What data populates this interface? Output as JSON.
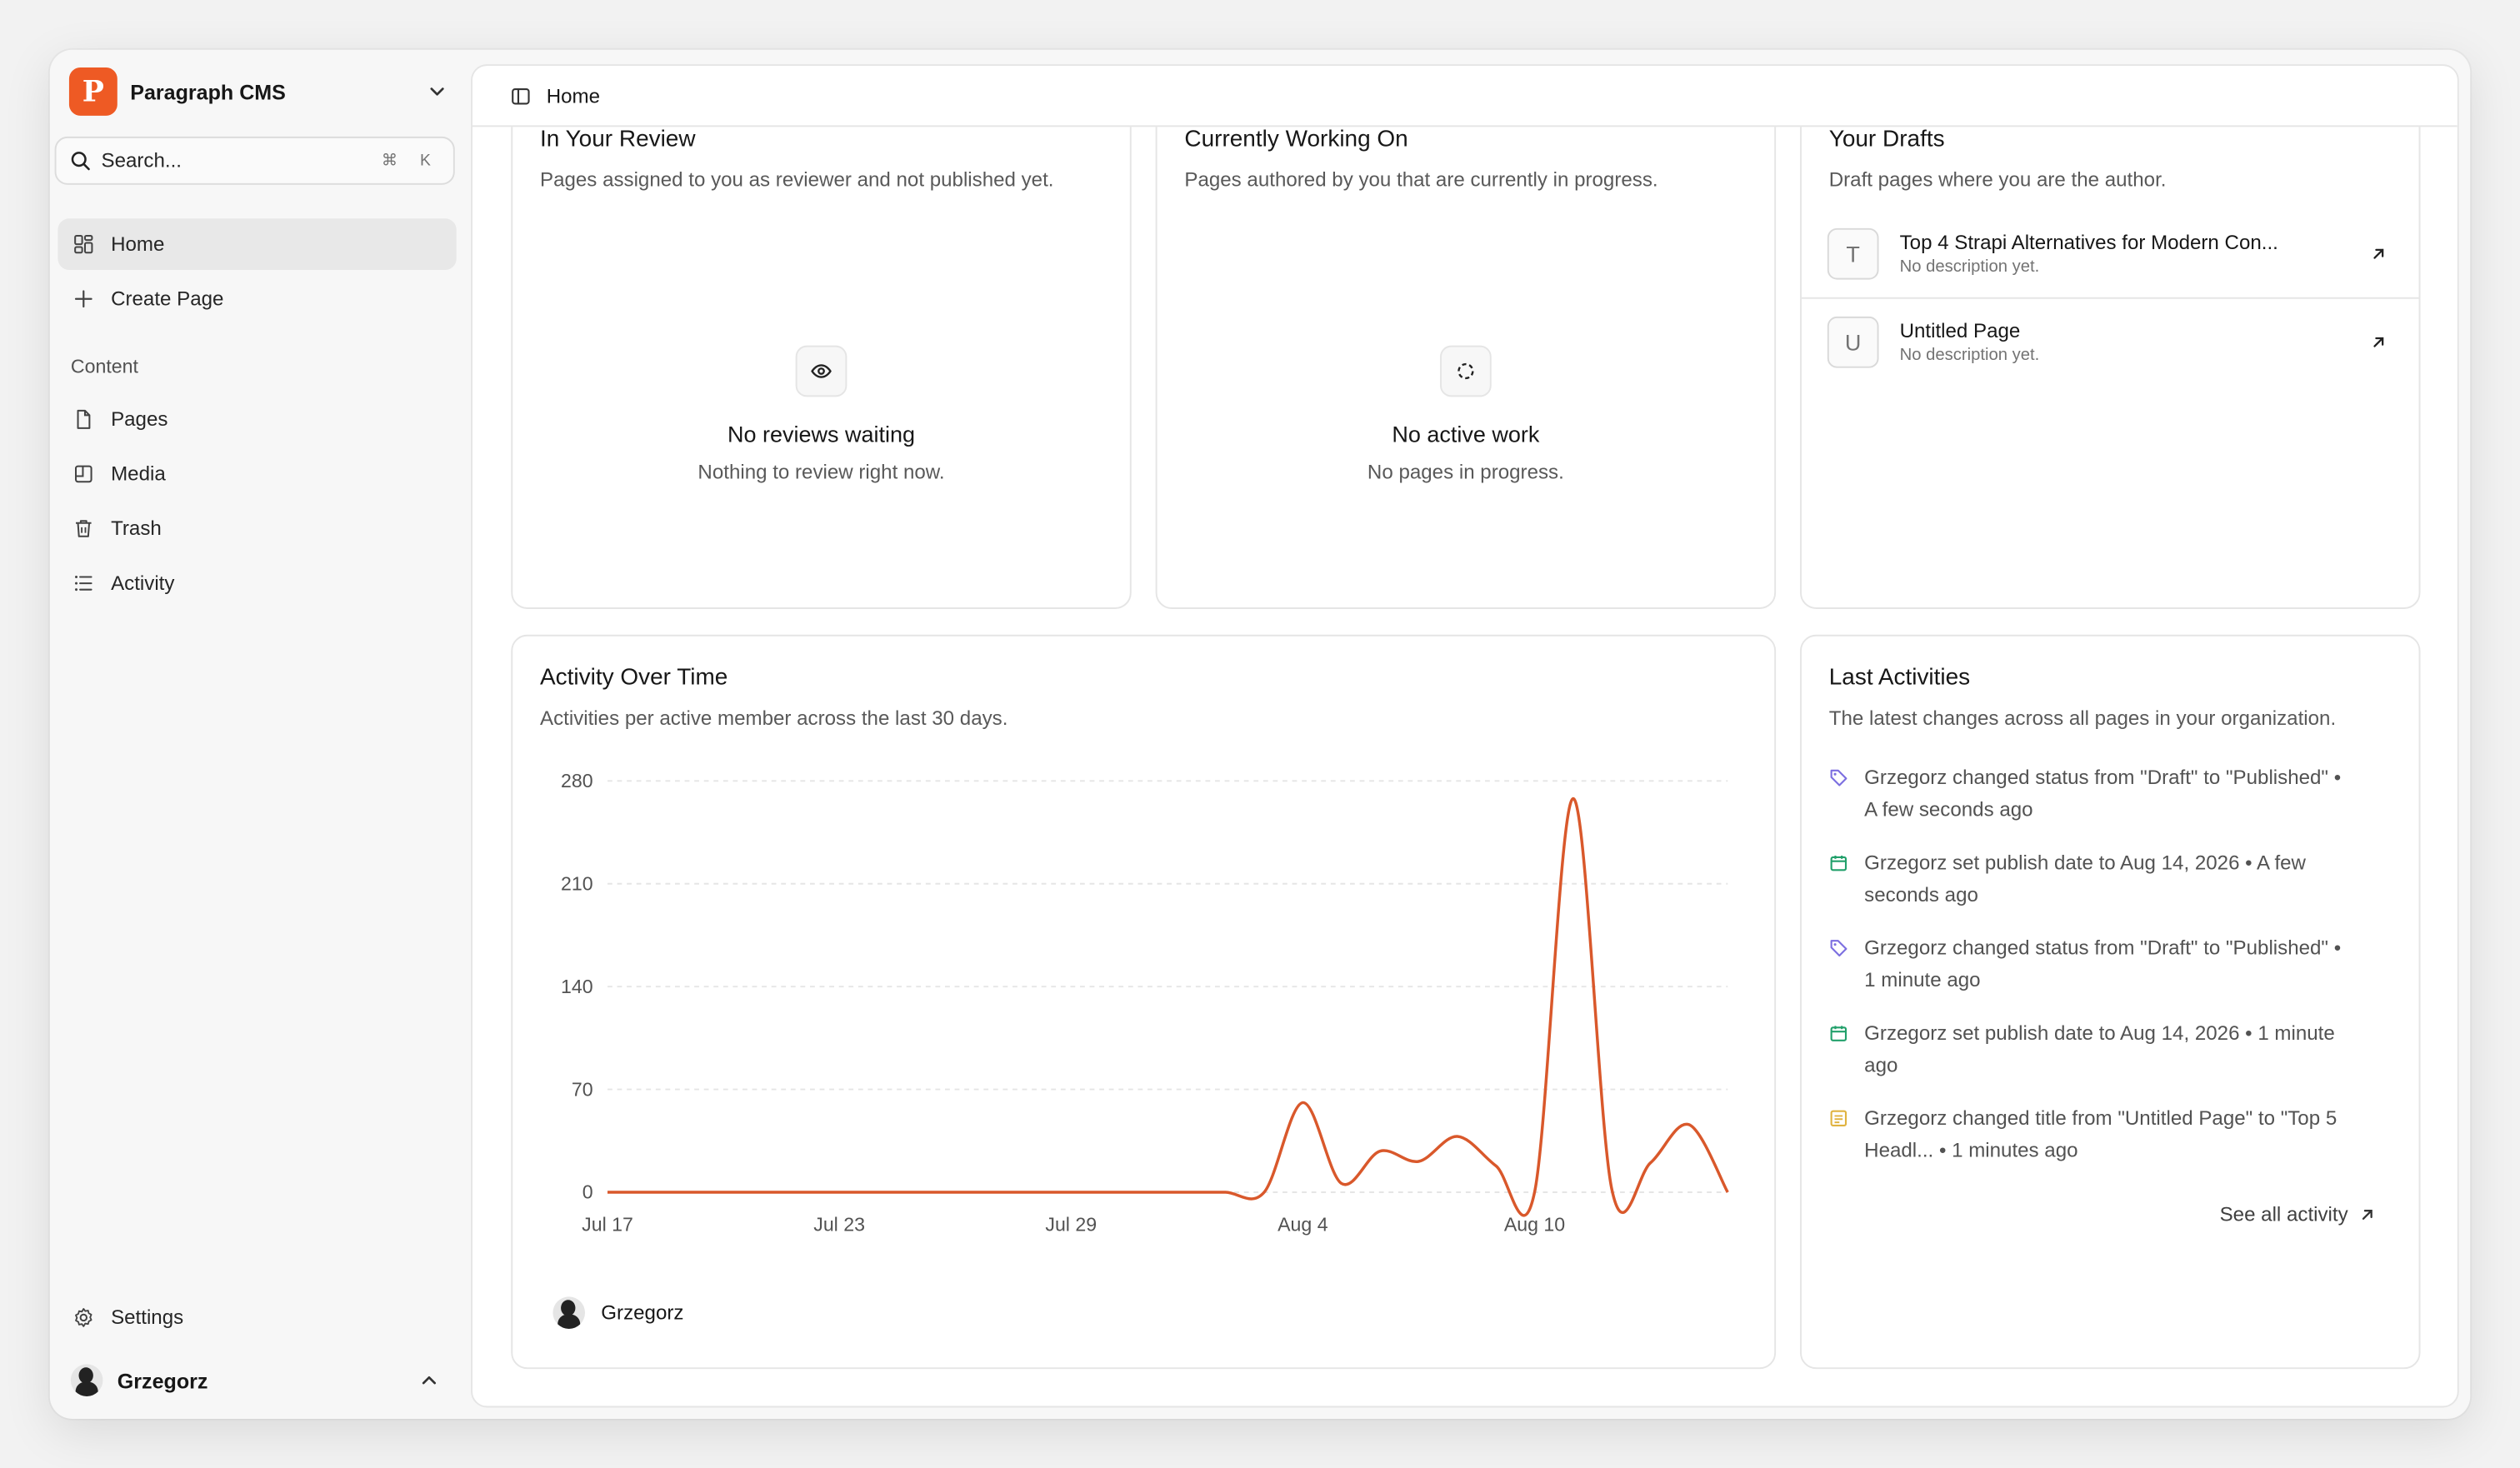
{
  "brand": {
    "name": "Paragraph CMS",
    "logo_glyph": "P",
    "color": "#ee5a24"
  },
  "search": {
    "placeholder": "Search...",
    "shortcut_mod": "⌘",
    "shortcut_key": "K"
  },
  "sidebar": {
    "items": [
      {
        "label": "Home",
        "icon": "home-grid-icon",
        "active": true
      },
      {
        "label": "Create Page",
        "icon": "plus-icon"
      }
    ],
    "section_label": "Content",
    "content_items": [
      {
        "label": "Pages",
        "icon": "file-icon"
      },
      {
        "label": "Media",
        "icon": "image-icon"
      },
      {
        "label": "Trash",
        "icon": "trash-icon"
      },
      {
        "label": "Activity",
        "icon": "list-icon"
      }
    ],
    "settings_label": "Settings",
    "user_name": "Grzegorz"
  },
  "topbar": {
    "title": "Home"
  },
  "review_card": {
    "title": "In Your Review",
    "subtitle": "Pages assigned to you as reviewer and not published yet.",
    "empty_title": "No reviews waiting",
    "empty_subtitle": "Nothing to review right now."
  },
  "working_card": {
    "title": "Currently Working On",
    "subtitle": "Pages authored by you that are currently in progress.",
    "empty_title": "No active work",
    "empty_subtitle": "No pages in progress."
  },
  "drafts_card": {
    "title": "Your Drafts",
    "subtitle": "Draft pages where you are the author.",
    "items": [
      {
        "letter": "T",
        "title": "Top 4 Strapi Alternatives for Modern Con...",
        "description": "No description yet."
      },
      {
        "letter": "U",
        "title": "Untitled Page",
        "description": "No description yet."
      }
    ]
  },
  "activity_chart_card": {
    "title": "Activity Over Time",
    "subtitle": "Activities per active member across the last 30 days.",
    "legend_name": "Grzegorz"
  },
  "chart_data": {
    "type": "line",
    "x_tick_labels": [
      "Jul 17",
      "Jul 23",
      "Jul 29",
      "Aug 4",
      "Aug 10"
    ],
    "y_ticks": [
      0,
      70,
      140,
      210,
      280
    ],
    "ylim": [
      0,
      280
    ],
    "grid": true,
    "color": "#d9582b",
    "series": [
      {
        "name": "Grzegorz",
        "x": [
          "Jul 17",
          "Jul 18",
          "Jul 19",
          "Jul 20",
          "Jul 21",
          "Jul 22",
          "Jul 23",
          "Jul 24",
          "Jul 25",
          "Jul 26",
          "Jul 27",
          "Jul 28",
          "Jul 29",
          "Jul 30",
          "Jul 31",
          "Aug 1",
          "Aug 2",
          "Aug 3",
          "Aug 4",
          "Aug 5",
          "Aug 6",
          "Aug 7",
          "Aug 8",
          "Aug 9",
          "Aug 10",
          "Aug 11",
          "Aug 12",
          "Aug 13",
          "Aug 14",
          "Aug 15"
        ],
        "values": [
          0,
          0,
          0,
          0,
          0,
          0,
          0,
          0,
          0,
          0,
          0,
          0,
          0,
          0,
          0,
          0,
          0,
          0,
          61,
          6,
          28,
          21,
          38,
          18,
          0,
          268,
          2,
          20,
          46,
          0
        ]
      }
    ]
  },
  "last_activities": {
    "title": "Last Activities",
    "subtitle": "The latest changes across all pages in your organization.",
    "items": [
      {
        "icon": "tag-icon",
        "color": "#7c6fe0",
        "line1": "Grzegorz changed status from \"Draft\" to \"Published\" •",
        "line2": "A few seconds ago"
      },
      {
        "icon": "calendar-icon",
        "color": "#22a06b",
        "line1": "Grzegorz set publish date to Aug 14, 2026 • A few",
        "line2": "seconds ago"
      },
      {
        "icon": "tag-icon",
        "color": "#7c6fe0",
        "line1": "Grzegorz changed status from \"Draft\" to \"Published\" •",
        "line2": "1 minute ago"
      },
      {
        "icon": "calendar-icon",
        "color": "#22a06b",
        "line1": "Grzegorz set publish date to Aug 14, 2026 • 1 minute",
        "line2": "ago"
      },
      {
        "icon": "title-icon",
        "color": "#e0b340",
        "line1": "Grzegorz changed title from \"Untitled Page\" to \"Top 5",
        "line2": "Headl... • 1 minutes ago"
      }
    ],
    "see_all_label": "See all activity"
  }
}
